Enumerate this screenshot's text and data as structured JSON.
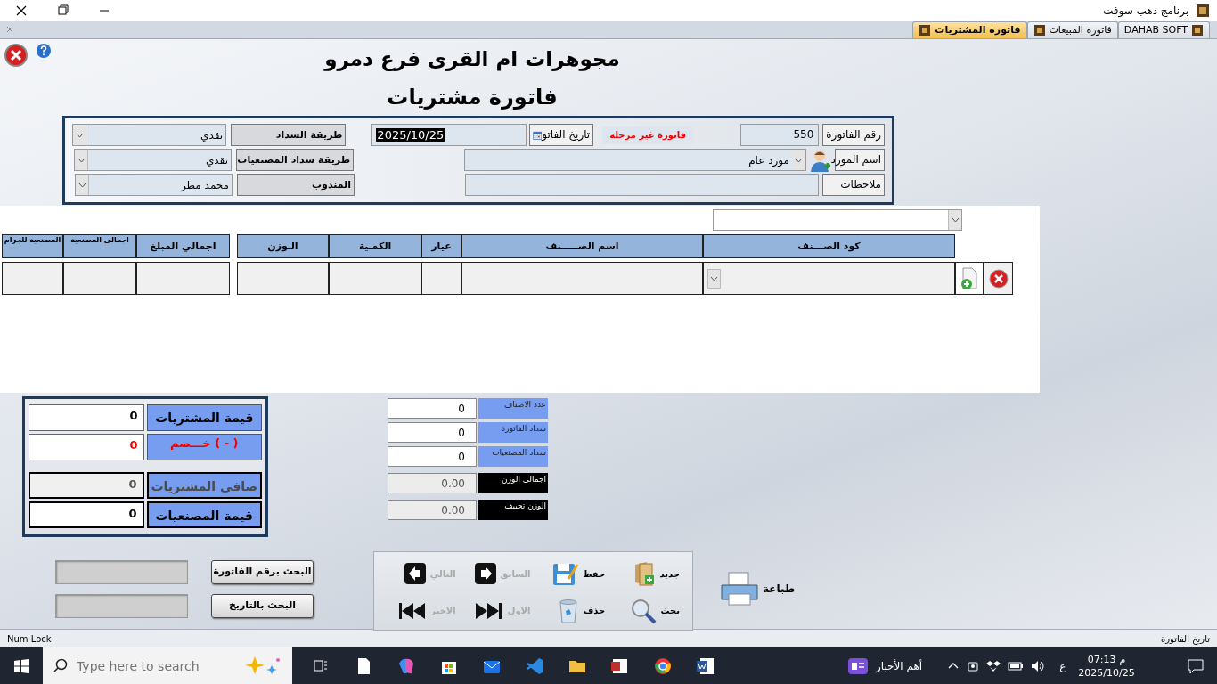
{
  "window": {
    "title": "برنامج دهب سوفت"
  },
  "tabs": [
    {
      "label": "DAHAB SOFT",
      "selected": false
    },
    {
      "label": "فاتورة المبيعات",
      "selected": false
    },
    {
      "label": "فاتورة المشتريات",
      "selected": true
    }
  ],
  "company_name": "مجوهرات ام القرى فرع دمرو",
  "form_title": "فاتورة مشتريات",
  "invoice": {
    "number_label": "رقم الفاتورة",
    "number": "550",
    "status": "فاتورة غير مرحله",
    "date_label": "تاريخ الفاتو",
    "date": "2025/10/25",
    "supplier_label": "اسم المورد",
    "supplier": "مورد عام",
    "notes_label": "ملاحظات"
  },
  "payment": [
    {
      "label": "طريقة السداد",
      "value": "نقدي"
    },
    {
      "label": "طريقة سداد المصنعيات",
      "value": "نقدي"
    },
    {
      "label": "المندوب",
      "value": "محمد مطر"
    }
  ],
  "table": {
    "columns": [
      "كود الصـــنف",
      "اسم الصـــــنف",
      "عيار",
      "الكمـية",
      "الـوزن"
    ],
    "totals_columns": [
      "اجمالي المبلغ",
      "اجمالى المصنعية",
      "المصنعية للجرام"
    ]
  },
  "totals": [
    {
      "label": "قيمة المشتريات",
      "value": "0",
      "kind": "normal"
    },
    {
      "label": "خـــصم  ( - )",
      "value": "0",
      "kind": "discount"
    },
    {
      "label": "صافى المشتريات",
      "value": "0",
      "kind": "disabled"
    },
    {
      "label": "قيمة المصنعيات",
      "value": "0",
      "kind": "strong"
    }
  ],
  "counters": [
    {
      "label": "عدد الاصناف",
      "value": "0",
      "kind": "input"
    },
    {
      "label": "سداد الفاتورة",
      "value": "0",
      "kind": "input"
    },
    {
      "label": "سداد المصنعيات",
      "value": "0",
      "kind": "input"
    },
    {
      "label": "اجمالى الوزن",
      "value": "0.00",
      "kind": "readonly"
    },
    {
      "label": "الوزن تحبيف",
      "value": "0.00",
      "kind": "readonly"
    }
  ],
  "actions": [
    {
      "label": "جديد",
      "kind": "new",
      "disabled": false
    },
    {
      "label": "حفظ",
      "kind": "save",
      "disabled": false
    },
    {
      "label": "السابق",
      "kind": "previous",
      "disabled": true
    },
    {
      "label": "التالي",
      "kind": "next",
      "disabled": true
    },
    {
      "label": "بحث",
      "kind": "search",
      "disabled": false
    },
    {
      "label": "حذف",
      "kind": "delete",
      "disabled": false
    },
    {
      "label": "الاول",
      "kind": "first",
      "disabled": true
    },
    {
      "label": "الاخير",
      "kind": "last",
      "disabled": true
    }
  ],
  "print_button": "طباعة",
  "search_buttons": [
    "البحث برقم الفاتورة",
    "البحث بالتاريخ"
  ],
  "status_bar": {
    "left": "Num Lock",
    "right": "تاريخ الفاتورة"
  },
  "taskbar": {
    "search_placeholder": "Type here to search",
    "news": "أهم الأخبار",
    "language": "ع",
    "period": "م",
    "time": "07:13",
    "date": "2025/10/25"
  }
}
